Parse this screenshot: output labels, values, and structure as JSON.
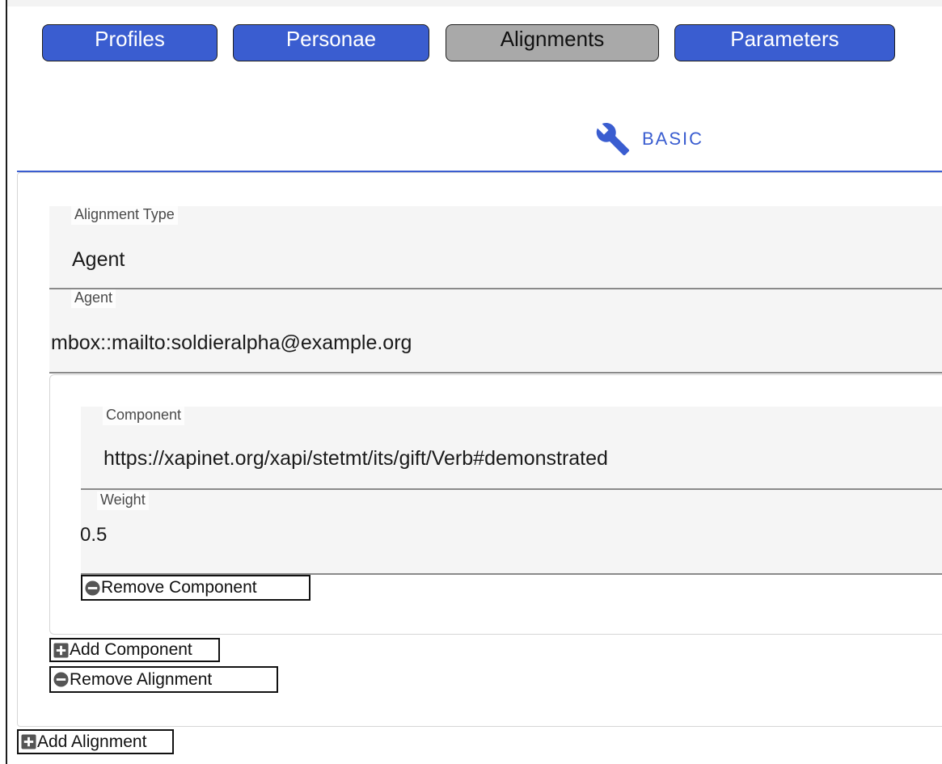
{
  "nav": {
    "tabs": [
      {
        "label": "Profiles",
        "active": false
      },
      {
        "label": "Personae",
        "active": false
      },
      {
        "label": "Alignments",
        "active": true
      },
      {
        "label": "Parameters",
        "active": false
      }
    ]
  },
  "subtab": {
    "label": "BASIC",
    "icon": "wrench-icon"
  },
  "alignment": {
    "type": {
      "label": "Alignment Type",
      "value": "Agent"
    },
    "agent": {
      "label": "Agent",
      "value": "mbox::mailto:soldieralpha@example.org"
    },
    "component": {
      "component_field": {
        "label": "Component",
        "value": "https://xapinet.org/xapi/stetmt/its/gift/Verb#demonstrated"
      },
      "weight_field": {
        "label": "Weight",
        "value": "0.5"
      },
      "remove_label": "Remove Component"
    },
    "add_component_label": "Add Component",
    "remove_alignment_label": "Remove Alignment"
  },
  "add_alignment_label": "Add Alignment",
  "colors": {
    "accent": "#3a5dd0",
    "inactive_tab": "#a9a9a9",
    "field_bg": "#f5f5f5"
  }
}
